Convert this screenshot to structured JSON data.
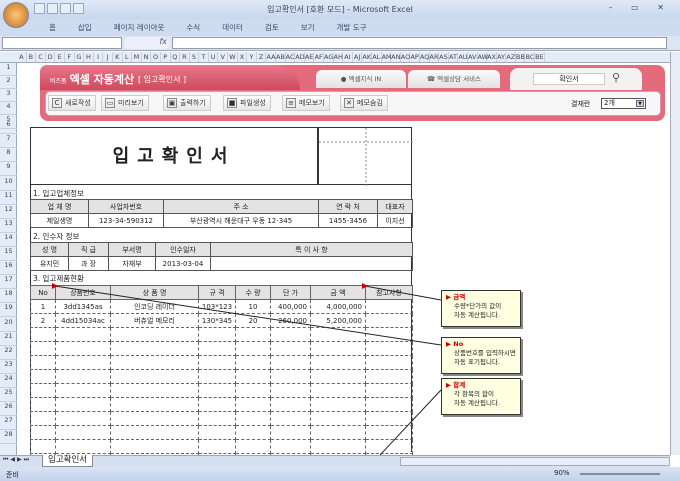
{
  "window": {
    "title": "입고확인서 [호환 모드] - Microsoft Excel",
    "controls": "– ▭ ✕"
  },
  "ribbon_tabs": [
    "홈",
    "삽입",
    "페이지 레이아웃",
    "수식",
    "데이터",
    "검토",
    "보기",
    "개발 도구"
  ],
  "formula_bar": {
    "fx": "fx",
    "name_box": "",
    "formula": ""
  },
  "columns": [
    "A",
    "B",
    "C",
    "D",
    "E",
    "F",
    "G",
    "H",
    "I",
    "J",
    "K",
    "L",
    "M",
    "N",
    "O",
    "P",
    "Q",
    "R",
    "S",
    "T",
    "U",
    "V",
    "W",
    "X",
    "Y",
    "Z",
    "AA",
    "AB",
    "AC",
    "AD",
    "AE",
    "AF",
    "AG",
    "AH",
    "AI",
    "AJ",
    "AK",
    "AL",
    "AM",
    "AN",
    "AO",
    "AP",
    "AQ",
    "AR",
    "AS",
    "AT",
    "AU",
    "AV",
    "AW",
    "AX",
    "AY",
    "AZ",
    "BB",
    "BC",
    "BE"
  ],
  "banner": {
    "brand_small": "비즈폼",
    "brand": "엑셀 자동계산",
    "doc_type": "[ 입고확인서 ]",
    "tab1": "● 엑셀지식 IN",
    "tab2": "☎ 엑셀상담 서비스",
    "search_value": "확인서"
  },
  "toolbar": {
    "buttons": [
      {
        "icon": "C",
        "label": "새로작성"
      },
      {
        "icon": "▭",
        "label": "미리보기"
      },
      {
        "icon": "▣",
        "label": "출력하기"
      },
      {
        "icon": "■",
        "label": "파일생성"
      },
      {
        "icon": "≡",
        "label": "메모보기"
      },
      {
        "icon": "✕",
        "label": "메모숨김"
      }
    ],
    "approval_label": "결재란",
    "approval_value": "2개"
  },
  "document": {
    "title": "입고확인서",
    "section1": "1. 입고업체정보",
    "supplier": {
      "headers": [
        "업 체 명",
        "사업자번호",
        "주        소",
        "연 락 처",
        "대표자"
      ],
      "row": [
        "제일생명",
        "123-34-590312",
        "부산광역시 해운대구 우동 12-345",
        "1455-3456",
        "이지선"
      ]
    },
    "section2": "2. 인수자 정보",
    "receiver": {
      "headers": [
        "성  명",
        "직  급",
        "부서명",
        "인수일자",
        "특 이 사 항"
      ],
      "row": [
        "유지민",
        "과  장",
        "자재부",
        "2013-03-04",
        ""
      ]
    },
    "section3": "3. 입고제품현황",
    "products": {
      "headers": [
        "No",
        "상품번호",
        "상 품 명",
        "규 격",
        "수 량",
        "단 가",
        "금 액",
        "참고사항"
      ],
      "rows": [
        [
          "1",
          "3dd1345as",
          "인코딩 레이더",
          "103*123",
          "10",
          "400,000",
          "4,000,000",
          ""
        ],
        [
          "2",
          "4dd15034ac",
          "버츄얼 메모리",
          "130*345",
          "20",
          "260,000",
          "5,200,000",
          ""
        ]
      ],
      "empty_rows": 10
    }
  },
  "comments": [
    {
      "title": "▶ 금액",
      "lines": [
        "수량*단가의 값이",
        "자동 계산됩니다."
      ]
    },
    {
      "title": "▶ No",
      "lines": [
        "상품번호를 입력하시면",
        "자동 표기됩니다."
      ]
    },
    {
      "title": "▶ 합계",
      "lines": [
        "각 항목의 합이",
        "자동 계산됩니다."
      ]
    }
  ],
  "sheet_tab": "입고확인서",
  "status": {
    "ready": "준비",
    "zoom": "90%"
  }
}
